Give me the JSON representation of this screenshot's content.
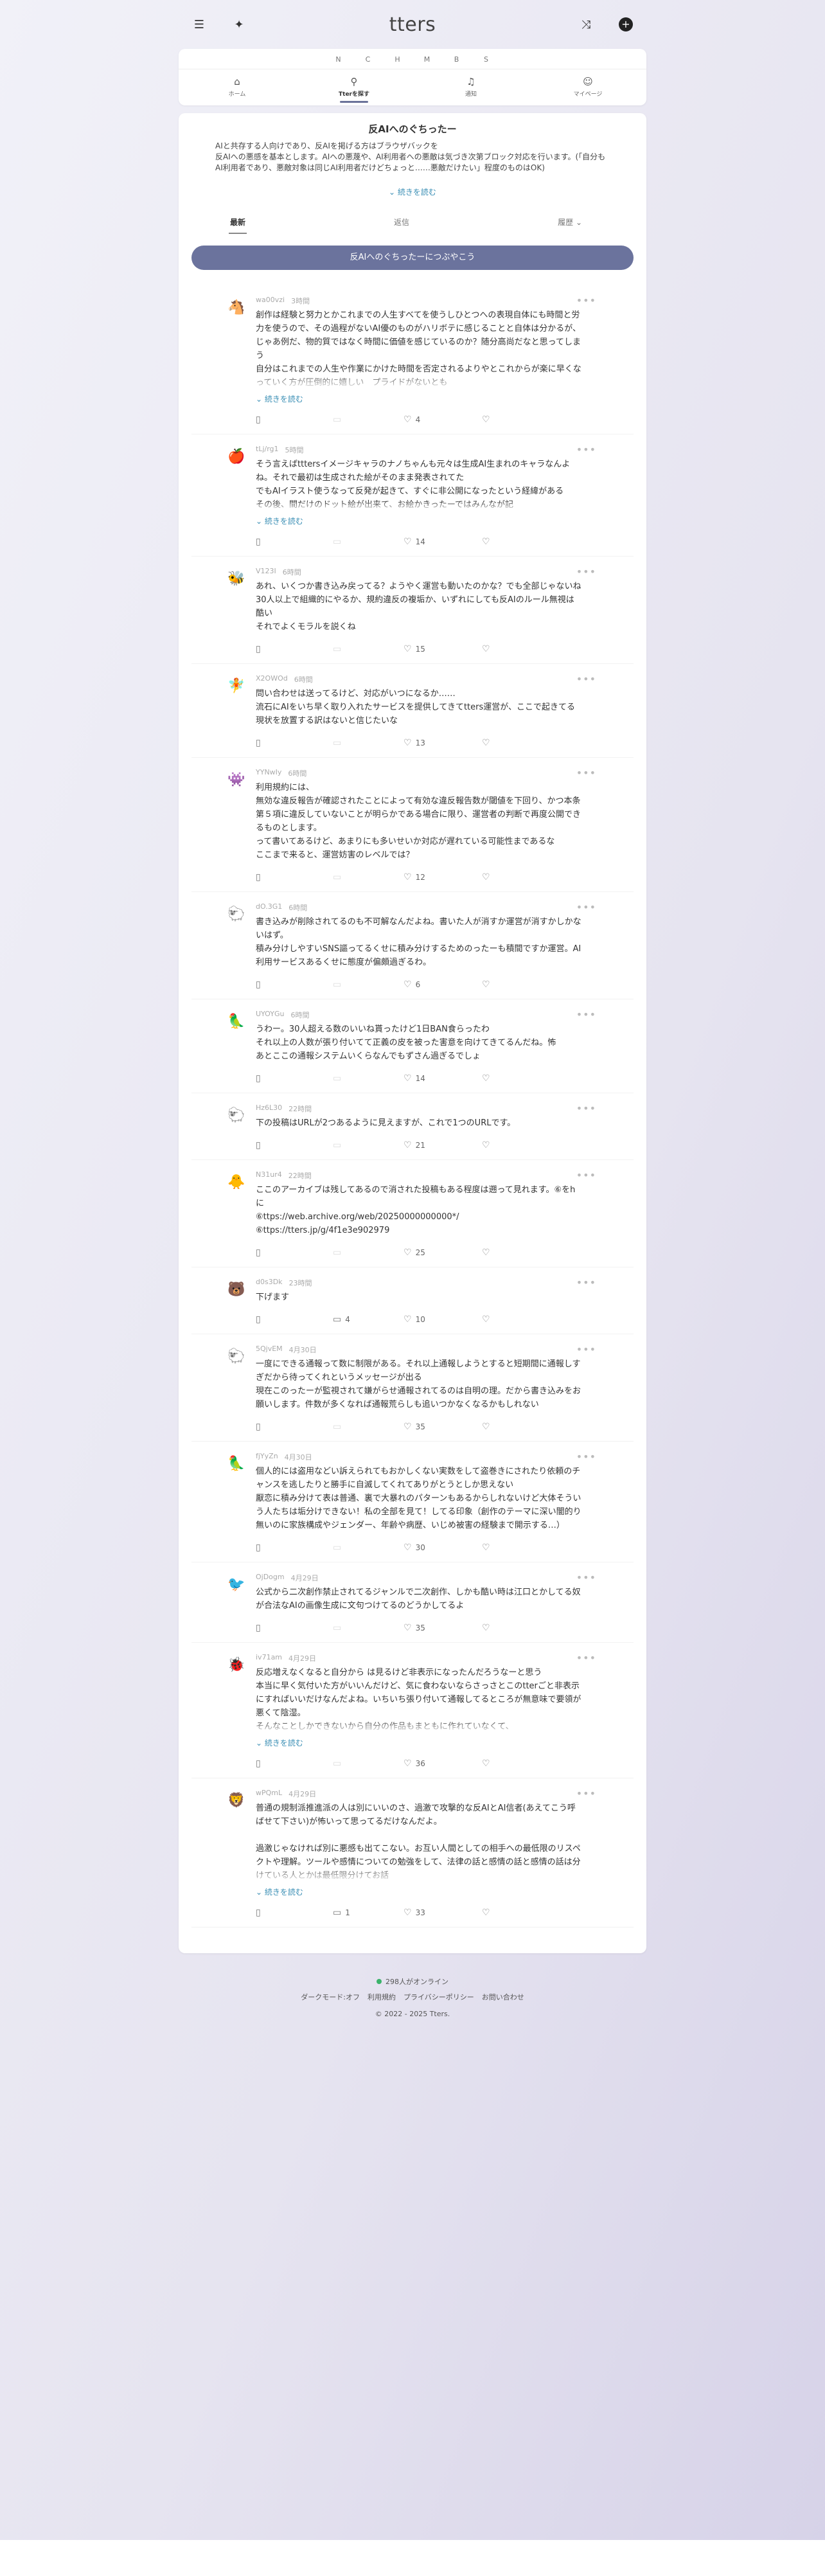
{
  "header": {
    "logo": "tters"
  },
  "letters": [
    "N",
    "C",
    "H",
    "M",
    "B",
    "S"
  ],
  "nav_tabs": [
    {
      "label": "ホーム",
      "icon": "home-icon",
      "active": false
    },
    {
      "label": "Tterを探す",
      "icon": "explore-icon",
      "active": true
    },
    {
      "label": "通知",
      "icon": "bell-icon",
      "active": false
    },
    {
      "label": "マイページ",
      "icon": "user-icon",
      "active": false
    }
  ],
  "board": {
    "title": "反AIへのぐちったー",
    "description": "AIと共存する人向けであり、反AIを掲げる方はブラウザバックを\n反AIへの悪感を基本とします。AIへの悪蔑や、AI利用者への悪敵は気づき次第ブロック対応を行います。(「自分もAI利用者であり、悪敵対象は同じAI利用者だけどちょっと……悪敵だけたい」程度のものはOK)",
    "read_more": "続きを読む"
  },
  "sort_tabs": {
    "latest": "最新",
    "replies": "返信",
    "history": "履歴"
  },
  "post_button": "反AIへのぐちったーにつぶやこう",
  "read_more": "続きを読む",
  "posts": [
    {
      "user": "wa00vzi",
      "time": "3時間",
      "avatar": "🐴",
      "body": "創作は経験と努力とかこれまでの人生すべてを使うしひとつへの表現自体にも時間と労力を使うので、その過程がないAI優のものがハリボテに感じることと自体は分かるが、じゃあ例だ、物的質ではなく時間に価値を感じているのか？随分高尚だなと思ってしまう\n自分はこれまでの人生や作業にかけた時間を否定されるよりやとこれからが楽に早くなっていく方が圧倒的に嬉しい　プライドがないとも",
      "replies": "",
      "likes": "4",
      "clipped": true
    },
    {
      "user": "tLj/rg1",
      "time": "5時間",
      "avatar": "🍎",
      "body": "そう言えばtttersイメージキャラのナノちゃんも元々は生成AI生まれのキャラなんよね。それで最初は生成された絵がそのまま発表されてた\nでもAIイラスト使うなって反発が起きて、すぐに非公開になったという経緯がある\nその後、間だけのドット絵が出来て、お絵かきったーではみんなが記",
      "replies": "",
      "likes": "14",
      "clipped": true
    },
    {
      "user": "V123I",
      "time": "6時間",
      "avatar": "🐝",
      "body": "あれ、いくつか書き込み戻ってる？ようやく運営も動いたのかな？でも全部じゃないね\n30人以上で組織的にやるか、規約違反の複垢か、いずれにしても反AIのルール無視は酷い\nそれでよくモラルを説くね",
      "replies": "",
      "likes": "15",
      "clipped": false
    },
    {
      "user": "X2OWOd",
      "time": "6時間",
      "avatar": "🧚",
      "body": "問い合わせは送ってるけど、対応がいつになるか……\n流石にAIをいち早く取り入れたサービスを提供してきてtters運営が、ここで起きてる現状を放置する訳はないと信じたいな",
      "replies": "",
      "likes": "13",
      "clipped": false
    },
    {
      "user": "YYNwIy",
      "time": "6時間",
      "avatar": "👾",
      "body": "利用規約には、\n無効な違反報告が確認されたことによって有効な違反報告数が閾値を下回り、かつ本条第５項に違反していないことが明らかである場合に限り、運営者の判断で再度公開できるものとします。\nって書いてあるけど、あまりにも多いせいか対応が遅れている可能性まであるな\nここまで来ると、運営妨害のレベルでは？",
      "replies": "",
      "likes": "12",
      "clipped": false
    },
    {
      "user": "dO.3G1",
      "time": "6時間",
      "avatar": "🐑",
      "body": "書き込みが削除されてるのも不可解なんだよね。書いた人が消すか運営が消すかしかないはず。\n積み分けしやすいSNS謳ってるくせに積み分けするためのったーも積間ですか運営。AI利用サービスあるくせに態度が偏頗過ぎるわ。",
      "replies": "",
      "likes": "6",
      "clipped": false
    },
    {
      "user": "UYOYGu",
      "time": "6時間",
      "avatar": "🦜",
      "body": "うわー。30人超える数のいいね貰ったけど1日BAN食らったわ\nそれ以上の人数が張り付いてて正義の皮を被った害意を向けてきてるんだね。怖\nあとここの通報システムいくらなんでもずさん過ぎるでしょ",
      "replies": "",
      "likes": "14",
      "clipped": false
    },
    {
      "user": "Hz6L30",
      "time": "22時間",
      "avatar": "🐑",
      "body": "下の投稿はURLが2つあるように見えますが、これで1つのURLです。",
      "replies": "",
      "likes": "21",
      "clipped": false
    },
    {
      "user": "N31ur4",
      "time": "22時間",
      "avatar": "🐥",
      "body": "ここのアーカイブは残してあるので消された投稿もある程度は遡って見れます。⑥をhに\n⑥ttps://web.archive.org/web/20250000000000*/\n⑥ttps://tters.jp/g/4f1e3e902979",
      "replies": "",
      "likes": "25",
      "clipped": false
    },
    {
      "user": "d0s3Dk",
      "time": "23時間",
      "avatar": "🐻",
      "body": "下げます",
      "replies": "4",
      "likes": "10",
      "clipped": false
    },
    {
      "user": "5QjvEM",
      "time": "4月30日",
      "avatar": "🐑",
      "body": "一度にできる通報って数に制限がある。それ以上通報しようとすると短期間に通報しすぎだから待ってくれというメッセージが出る\n現在このったーが監視されて嫌がらせ通報されてるのは自明の理。だから書き込みをお願いします。件数が多くなれば通報荒らしも追いつかなくなるかもしれない",
      "replies": "",
      "likes": "35",
      "clipped": false
    },
    {
      "user": "fjYyZn",
      "time": "4月30日",
      "avatar": "🦜",
      "body": "個人的には盗用などい訴えられてもおかしくない実数をして盗巻きにされたり依頼のチャンスを逃したりと勝手に自滅してくれてありがとうとしか思えない\n厭恋に積み分けて表は普通、裏で大暴れのパターンもあるからしれないけど大体そういう人たちは垢分けできない！私の全部を見て！してる印象（創作のテーマに深い闇的り無いのに家族構成やジェンダー、年齢や病歴、いじめ被害の経験まで開示する…）",
      "replies": "",
      "likes": "30",
      "clipped": false
    },
    {
      "user": "OjDogm",
      "time": "4月29日",
      "avatar": "🐦",
      "body": "公式から二次創作禁止されてるジャンルで二次創作、しかも酷い時は江口とかしてる奴が合法なAIの画像生成に文句つけてるのどうかしてるよ",
      "replies": "",
      "likes": "35",
      "clipped": false
    },
    {
      "user": "iv71am",
      "time": "4月29日",
      "avatar": "🐞",
      "body": "反応増えなくなると自分から は見るけど非表示になったんだろうなーと思う\n本当に早く気付いた方がいいんだけど、気に食わないならさっさとこのtterごと非表示にすればいいだけなんだよね。いちいち張り付いて通報してるところが無意味で要領が悪くて陰湿。\nそんなことしかできないから自分の作品もまともに作れていなくて、",
      "replies": "",
      "likes": "36",
      "clipped": true
    },
    {
      "user": "wPQmL",
      "time": "4月29日",
      "avatar": "🦁",
      "body": "普通の規制派推進派の人は別にいいのさ、過激で攻撃的な反AIとAI信者(あえてこう呼ばせて下さい)が怖いって思ってるだけなんだよ。\n\n過激じゃなければ別に悪感も出てこない。お互い人間としての相手への最低限のリスペクトや理解。ツールや感情についての勉強をして、法律の話と感情の話と感情の話は分けている人とかは最低限分けてお話",
      "replies": "1",
      "likes": "33",
      "clipped": true
    }
  ],
  "footer": {
    "online": "298人がオンライン",
    "links": [
      "ダークモード:オフ",
      "利用規約",
      "プライバシーポリシー",
      "お問い合わせ"
    ],
    "copyright": "© 2022 - 2025 Tters."
  }
}
